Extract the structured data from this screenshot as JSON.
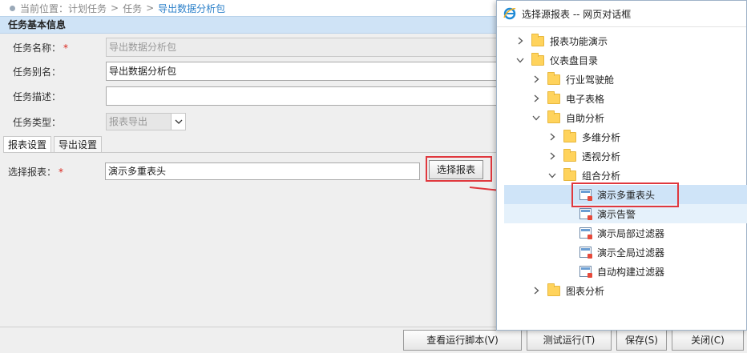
{
  "breadcrumb": {
    "prefix": "当前位置：",
    "items": [
      "计划任务",
      "任务"
    ],
    "current": "导出数据分析包",
    "separator": ">"
  },
  "section": {
    "title": "任务基本信息"
  },
  "form": {
    "name_label": "任务名称：",
    "name_value": "导出数据分析包",
    "alias_label": "任务别名：",
    "alias_value": "导出数据分析包",
    "desc_label": "任务描述：",
    "desc_value": "",
    "type_label": "任务类型：",
    "type_value": "报表导出",
    "required_mark": "*"
  },
  "tabs": [
    "报表设置",
    "导出设置"
  ],
  "report": {
    "label": "选择报表：",
    "value": "演示多重表头",
    "button": "选择报表"
  },
  "footer": {
    "view_script": "查看运行脚本(V)",
    "test_run": "测试运行(T)",
    "save": "保存(S)",
    "close": "关闭(C)"
  },
  "dialog": {
    "title": "选择源报表 -- 网页对话框",
    "tree": [
      {
        "label": "报表功能演示",
        "kind": "folder",
        "state": "collapsed",
        "level": 0
      },
      {
        "label": "仪表盘目录",
        "kind": "folder",
        "state": "expanded",
        "level": 0
      },
      {
        "label": "行业驾驶舱",
        "kind": "folder",
        "state": "collapsed",
        "level": 1
      },
      {
        "label": "电子表格",
        "kind": "folder",
        "state": "collapsed",
        "level": 1
      },
      {
        "label": "自助分析",
        "kind": "folder",
        "state": "expanded",
        "level": 1
      },
      {
        "label": "多维分析",
        "kind": "folder",
        "state": "collapsed",
        "level": 2
      },
      {
        "label": "透视分析",
        "kind": "folder",
        "state": "collapsed",
        "level": 2
      },
      {
        "label": "组合分析",
        "kind": "folder",
        "state": "expanded",
        "level": 2
      },
      {
        "label": "演示多重表头",
        "kind": "report",
        "state": "selected",
        "level": 3
      },
      {
        "label": "演示告警",
        "kind": "report",
        "state": "hover",
        "level": 3
      },
      {
        "label": "演示局部过滤器",
        "kind": "report",
        "state": "",
        "level": 3
      },
      {
        "label": "演示全局过滤器",
        "kind": "report",
        "state": "",
        "level": 3
      },
      {
        "label": "自动构建过滤器",
        "kind": "report",
        "state": "",
        "level": 3
      },
      {
        "label": "图表分析",
        "kind": "folder",
        "state": "collapsed",
        "level": 1
      }
    ]
  },
  "colors": {
    "accent": "#2a7fc9",
    "highlight": "#e0383e",
    "section_bg": "#cfe3f6",
    "selected_bg": "#cfe4f8"
  }
}
